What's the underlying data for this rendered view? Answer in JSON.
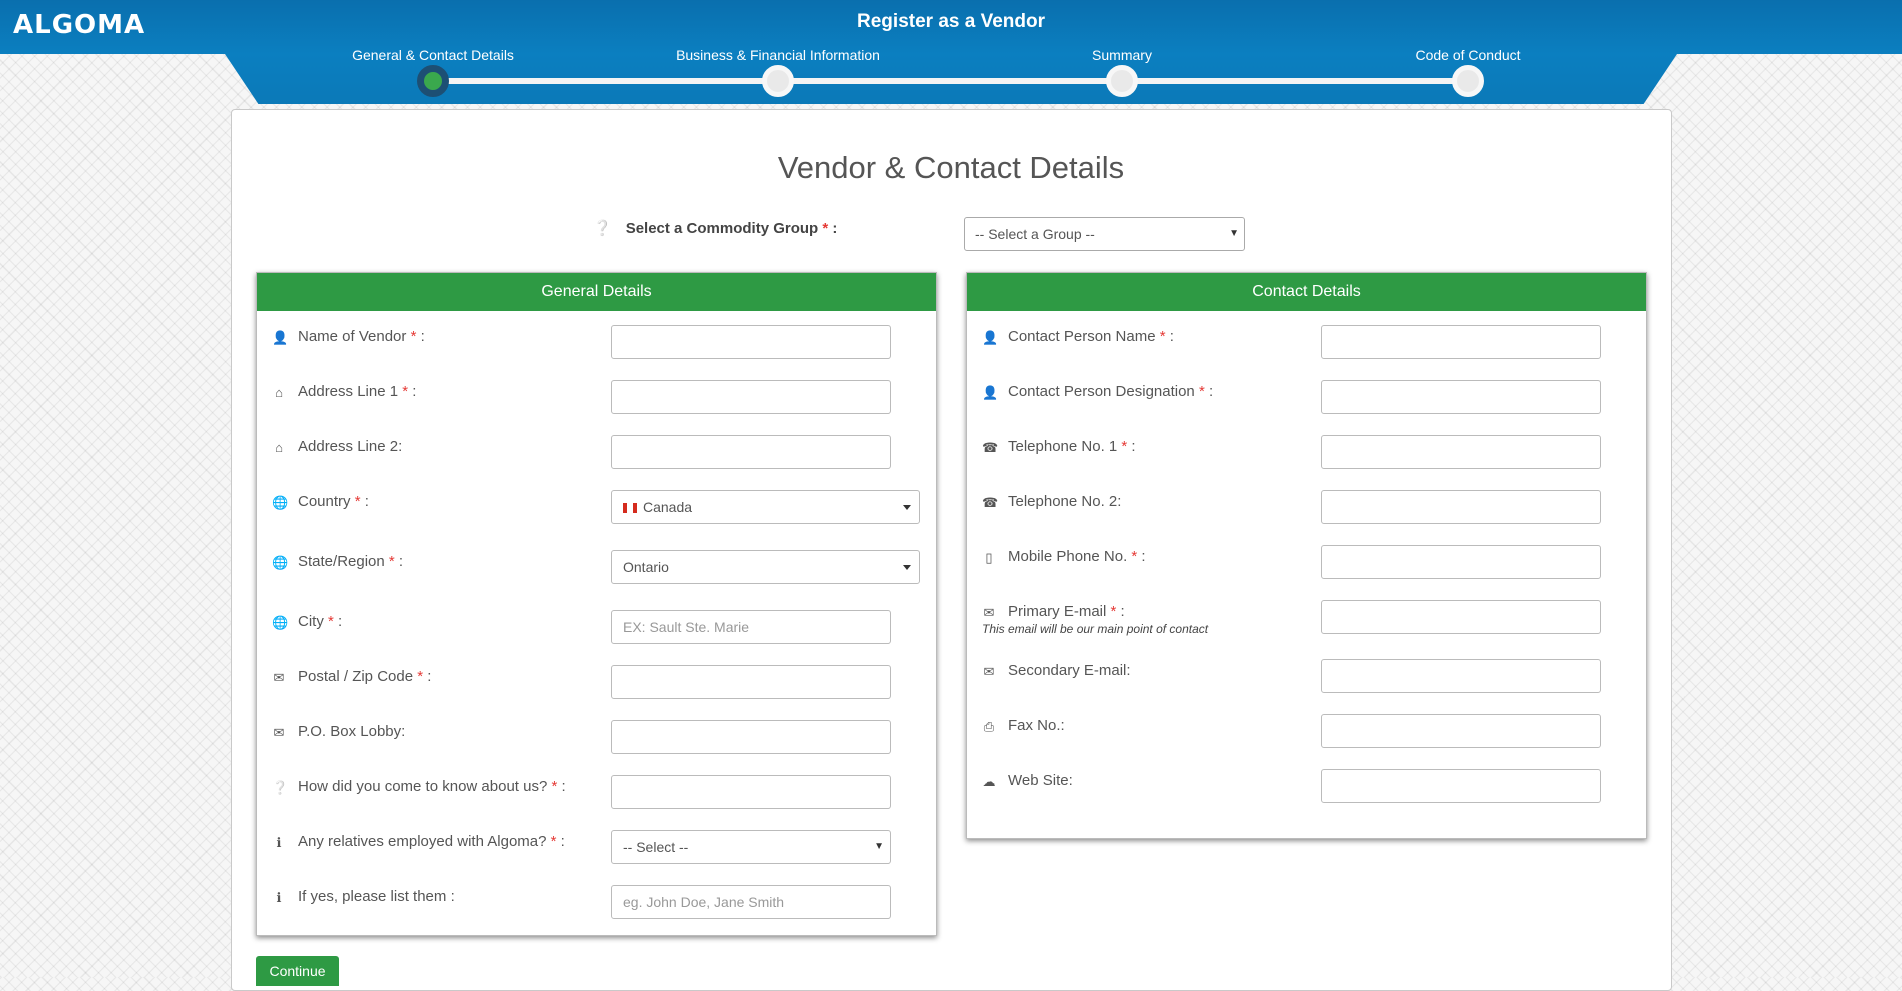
{
  "header": {
    "logo": "ALGOMA",
    "title": "Register as a Vendor",
    "steps": [
      {
        "label": "General & Contact Details",
        "active": true
      },
      {
        "label": "Business & Financial Information",
        "active": false
      },
      {
        "label": "Summary",
        "active": false
      },
      {
        "label": "Code of Conduct",
        "active": false
      }
    ]
  },
  "main": {
    "title": "Vendor & Contact Details",
    "commodity": {
      "label": "Select a Commodity Group",
      "required_mark": "*",
      "suffix": ":",
      "value": "-- Select a Group --"
    }
  },
  "general": {
    "header": "General Details",
    "fields": [
      {
        "label": "Name of Vendor",
        "required": "*",
        "icon": "user-icon",
        "value": ""
      },
      {
        "label": "Address Line 1",
        "required": "*",
        "icon": "home-icon",
        "value": ""
      },
      {
        "label": "Address Line 2:",
        "required": "",
        "icon": "home-icon",
        "value": ""
      },
      {
        "label": "Country",
        "required": "*",
        "icon": "globe-icon",
        "value": "Canada"
      },
      {
        "label": "State/Region",
        "required": "*",
        "icon": "globe-icon",
        "value": "Ontario"
      },
      {
        "label": "City",
        "required": "*",
        "icon": "globe-icon",
        "placeholder": "EX: Sault Ste. Marie"
      },
      {
        "label": "Postal / Zip Code",
        "required": "*",
        "icon": "envelope-icon",
        "value": ""
      },
      {
        "label": "P.O. Box Lobby:",
        "required": "",
        "icon": "envelope-icon",
        "value": ""
      },
      {
        "label": "How did you come to know about us?",
        "required": "*",
        "icon": "question-icon",
        "value": ""
      },
      {
        "label": "Any relatives employed with Algoma?",
        "required": "*",
        "icon": "info-icon",
        "value": "-- Select --"
      },
      {
        "label": "If yes, please list them :",
        "required": "",
        "icon": "info-icon",
        "placeholder": "eg. John Doe, Jane Smith"
      }
    ]
  },
  "contact": {
    "header": "Contact Details",
    "fields": [
      {
        "label": "Contact Person Name",
        "required": "*",
        "icon": "user-icon",
        "value": ""
      },
      {
        "label": "Contact Person Designation",
        "required": "*",
        "icon": "user-icon",
        "value": ""
      },
      {
        "label": "Telephone No. 1",
        "required": "*",
        "icon": "phone-icon",
        "value": ""
      },
      {
        "label": "Telephone No. 2:",
        "required": "",
        "icon": "phone-icon",
        "value": ""
      },
      {
        "label": "Mobile Phone No.",
        "required": "*",
        "icon": "mobile-icon",
        "value": ""
      },
      {
        "label": "Primary E-mail",
        "required": "*",
        "icon": "envelope-icon",
        "value": "",
        "note": "This email will be our main point of contact"
      },
      {
        "label": "Secondary E-mail:",
        "required": "",
        "icon": "envelope-icon",
        "value": ""
      },
      {
        "label": "Fax No.:",
        "required": "",
        "icon": "print-icon",
        "value": ""
      },
      {
        "label": "Web Site:",
        "required": "",
        "icon": "cloud-icon",
        "value": ""
      }
    ]
  },
  "actions": {
    "continue": "Continue"
  },
  "colors": {
    "header_blue": "#0b7fc0",
    "panel_green": "#2e9a44",
    "required_red": "#e53935",
    "active_ring": "#1d4f74"
  }
}
